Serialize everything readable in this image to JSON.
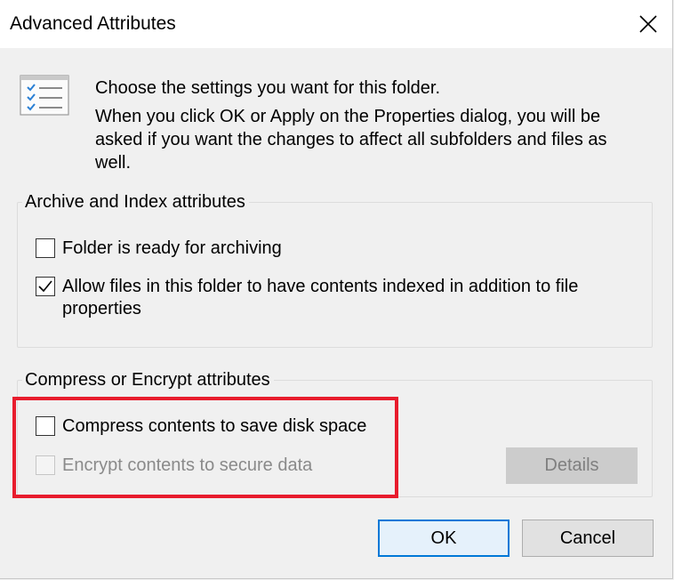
{
  "window": {
    "title": "Advanced Attributes",
    "close_icon": "close-icon"
  },
  "intro": {
    "icon": "settings-list-icon",
    "line1": "Choose the settings you want for this folder.",
    "line2": "When you click OK or Apply on the Properties dialog, you will be asked if you want the changes to affect all subfolders and files as well."
  },
  "archive_group": {
    "label": "Archive and Index attributes",
    "options": [
      {
        "label": "Folder is ready for archiving",
        "checked": false,
        "enabled": true
      },
      {
        "label": "Allow files in this folder to have contents indexed in addition to file properties",
        "checked": true,
        "enabled": true
      }
    ]
  },
  "compress_group": {
    "label": "Compress or Encrypt attributes",
    "options": [
      {
        "label": "Compress contents to save disk space",
        "checked": false,
        "enabled": true
      },
      {
        "label": "Encrypt contents to secure data",
        "checked": false,
        "enabled": false
      }
    ],
    "details_label": "Details"
  },
  "buttons": {
    "ok": "OK",
    "cancel": "Cancel"
  },
  "colors": {
    "highlight": "#e81c2d",
    "accent": "#0078d7"
  }
}
